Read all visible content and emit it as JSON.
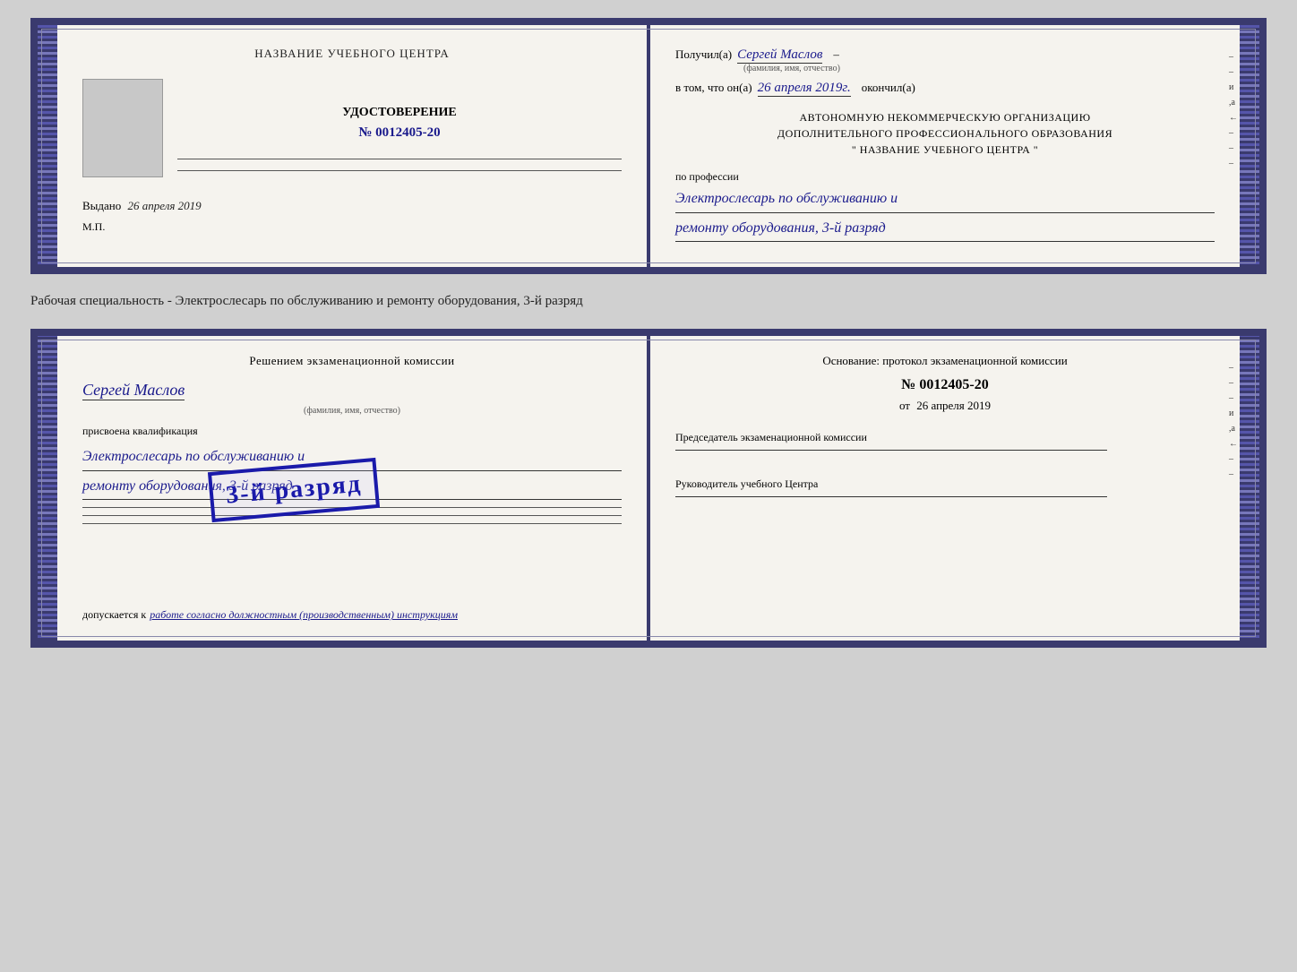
{
  "card1": {
    "left": {
      "title": "НАЗВАНИЕ УЧЕБНОГО ЦЕНТРА",
      "udost_label": "УДОСТОВЕРЕНИЕ",
      "number_prefix": "№",
      "number_value": "0012405-20",
      "vydano_label": "Выдано",
      "vydano_date": "26 апреля 2019",
      "mp_label": "М.П."
    },
    "right": {
      "poluchil_label": "Получил(а)",
      "poluchil_name": "Сергей Маслов",
      "fio_small": "(фамилия, имя, отчество)",
      "dash": "–",
      "vtom_label": "в том, что он(а)",
      "vtom_date": "26 апреля 2019г.",
      "okonchil_label": "окончил(а)",
      "org_text_1": "АВТОНОМНУЮ НЕКОММЕРЧЕСКУЮ ОРГАНИЗАЦИЮ",
      "org_text_2": "ДОПОЛНИТЕЛЬНОГО ПРОФЕССИОНАЛЬНОГО ОБРАЗОВАНИЯ",
      "org_text_3": "\"   НАЗВАНИЕ УЧЕБНОГО ЦЕНТРА   \"",
      "po_professii_label": "по профессии",
      "profession_line1": "Электрослесарь по обслуживанию и",
      "profession_line2": "ремонту оборудования, 3-й разряд"
    }
  },
  "specialty_text": "Рабочая специальность - Электрослесарь по обслуживанию и ремонту оборудования, 3-й разряд",
  "card2": {
    "left": {
      "title": "Решением экзаменационной комиссии",
      "name": "Сергей Маслов",
      "fio_small": "(фамилия, имя, отчество)",
      "prisvoena_label": "присвоена квалификация",
      "qualification_line1": "Электрослесарь по обслуживанию и",
      "qualification_line2": "ремонту оборудования, 3-й разряд",
      "dopuskaetsya_label": "допускается к",
      "dopuskaetsya_text": "работе согласно должностным (производственным) инструкциям",
      "stamp_text": "3-й разряд"
    },
    "right": {
      "osnov_label": "Основание: протокол экзаменационной комиссии",
      "number_prefix": "№",
      "number_value": "0012405-20",
      "ot_label": "от",
      "ot_date": "26 апреля 2019",
      "predsed_label": "Председатель экзаменационной комиссии",
      "ruk_label": "Руководитель учебного Центра"
    }
  }
}
